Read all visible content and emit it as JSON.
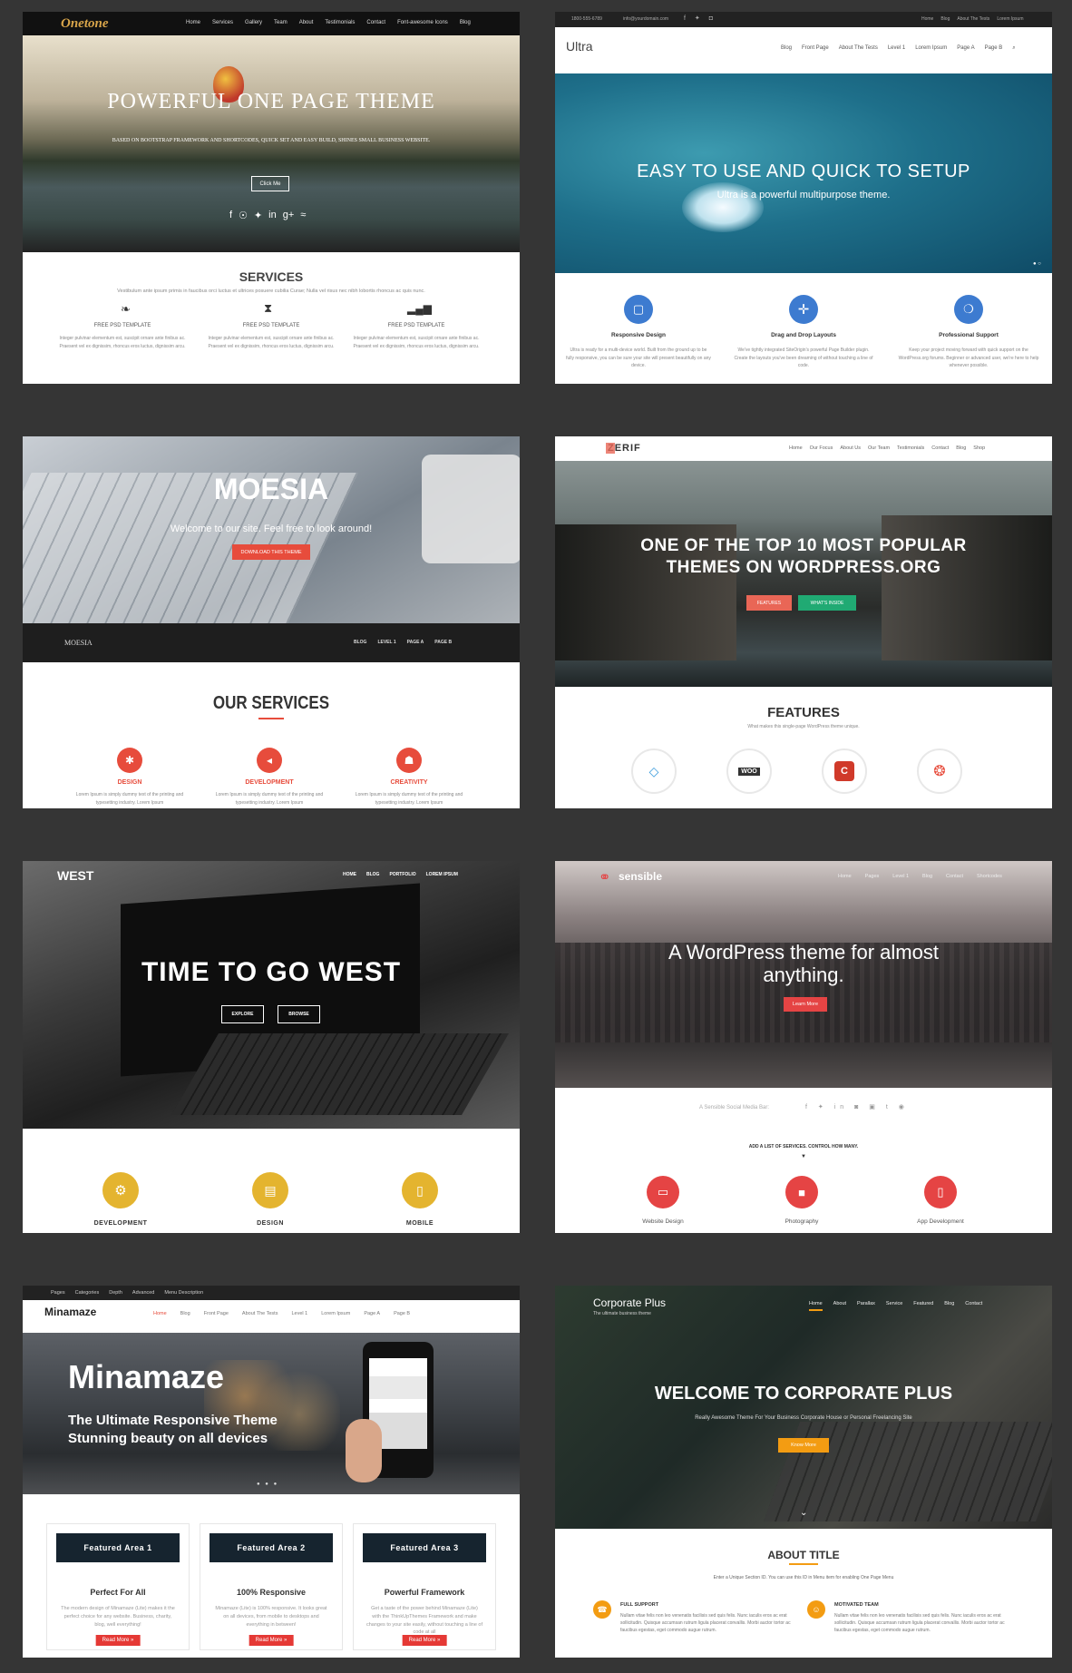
{
  "onetone": {
    "logo": "Onetone",
    "nav": [
      "Home",
      "Services",
      "Gallery",
      "Team",
      "About",
      "Testimonials",
      "Contact",
      "Font-awesome Icons",
      "Blog"
    ],
    "title": "POWERFUL ONE PAGE THEME",
    "subtitle": "BASED ON BOOTSTRAP FRAMEWORK AND SHORTCODES, QUICK SET AND EASY BUILD, SHINES SMALL BUSINESS WEBSITE.",
    "cta": "Click Me",
    "services_title": "SERVICES",
    "services_sub": "Vestibulum ante ipsum primis in faucibus orci luctus et ultrices posuere cubilia Curae; Nulla vel risus nec nibh lobortis rhoncus ac quis nunc.",
    "items": [
      {
        "title": "FREE PSD TEMPLATE",
        "text": "Integer pulvinar elementum est, suscipit ornare ante finibus ac. Praesent vel ex dignissim, rhoncus eros luctus, dignissim arcu."
      },
      {
        "title": "FREE PSD TEMPLATE",
        "text": "Integer pulvinar elementum est, suscipit ornare ante finibus ac. Praesent vel ex dignissim, rhoncus eros luctus, dignissim arcu."
      },
      {
        "title": "FREE PSD TEMPLATE",
        "text": "Integer pulvinar elementum est, suscipit ornare ante finibus ac. Praesent vel ex dignissim, rhoncus eros luctus, dignissim arcu."
      }
    ]
  },
  "ultra": {
    "phone": "1800-555-6789",
    "email": "info@yourdomain.com",
    "topnav": [
      "Home",
      "Blog",
      "About The Tests",
      "Lorem Ipsum"
    ],
    "logo": "Ultra",
    "nav": [
      "Blog",
      "Front Page",
      "About The Tests",
      "Level 1",
      "Lorem Ipsum",
      "Page A",
      "Page B"
    ],
    "title": "EASY TO USE AND QUICK TO SETUP",
    "subtitle": "Ultra is a powerful multipurpose theme.",
    "features": [
      {
        "title": "Responsive Design",
        "text": "Ultra is ready for a multi-device world. Built from the ground up to be fully responsive, you can be sure your site will present beautifully on any device."
      },
      {
        "title": "Drag and Drop Layouts",
        "text": "We've tightly integrated SiteOrigin's powerful Page Builder plugin. Create the layouts you've been dreaming of without touching a line of code."
      },
      {
        "title": "Professional Support",
        "text": "Keep your project moving forward with quick support on the WordPress.org forums. Beginner or advanced user, we're here to help whenever possible."
      }
    ],
    "accent": "#3d7bd0"
  },
  "moesia": {
    "title": "MOESIA",
    "subtitle": "Welcome to our site. Feel free to look around!",
    "cta": "DOWNLOAD THIS THEME",
    "bar_logo": "MOESIA",
    "bar_nav": [
      "BLOG",
      "LEVEL 1",
      "PAGE A",
      "PAGE B"
    ],
    "section": "OUR SERVICES",
    "services": [
      {
        "title": "DESIGN",
        "text": "Lorem Ipsum is simply dummy text of the printing and typesetting industry. Lorem Ipsum"
      },
      {
        "title": "DEVELOPMENT",
        "text": "Lorem Ipsum is simply dummy text of the printing and typesetting industry. Lorem Ipsum"
      },
      {
        "title": "CREATIVITY",
        "text": "Lorem Ipsum is simply dummy text of the printing and typesetting industry. Lorem Ipsum"
      }
    ],
    "accent": "#e74c3c"
  },
  "zerif": {
    "logo": "ZERIF",
    "nav": [
      "Home",
      "Our Focus",
      "About Us",
      "Our Team",
      "Testimonials",
      "Contact",
      "Blog",
      "Shop"
    ],
    "title1": "ONE OF THE TOP 10 MOST POPULAR",
    "title2": "THEMES ON WORDPRESS.ORG",
    "btn1": "FEATURES",
    "btn2": "WHAT'S INSIDE",
    "section": "FEATURES",
    "section_sub": "What makes this single-page WordPress theme unique.",
    "woo": "WOO"
  },
  "west": {
    "logo": "WEST",
    "nav": [
      "HOME",
      "BLOG",
      "PORTFOLIO",
      "LOREM IPSUM"
    ],
    "title": "TIME TO GO WEST",
    "btn1": "EXPLORE",
    "btn2": "BROWSE",
    "services": [
      "DEVELOPMENT",
      "DESIGN",
      "MOBILE"
    ],
    "accent": "#e4b42f"
  },
  "sensible": {
    "logo": "sensible",
    "nav": [
      "Home",
      "Pages",
      "Level 1",
      "Blog",
      "Contact",
      "Shortcodes"
    ],
    "title1": "A WordPress theme for almost",
    "title2": "anything.",
    "cta": "Learn More",
    "social_label": "A Sensible Social Media Bar:",
    "services_title": "ADD A LIST OF SERVICES. CONTROL HOW MANY.",
    "services": [
      "Website Design",
      "Photography",
      "App Development"
    ],
    "accent": "#e54444"
  },
  "minamaze": {
    "topnav": [
      "Pages",
      "Categories",
      "Depth",
      "Advanced",
      "Menu Description"
    ],
    "logo": "Minamaze",
    "nav": [
      "Home",
      "Blog",
      "Front Page",
      "About The Tests",
      "Level 1",
      "Lorem Ipsum",
      "Page A",
      "Page B"
    ],
    "title": "Minamaze",
    "sub1": "The Ultimate Responsive Theme",
    "sub2": "Stunning beauty on all devices",
    "boxes": [
      {
        "head": "Featured Area 1",
        "title": "Perfect For All",
        "text": "The modern design of Minamaze (Lite) makes it the perfect choice for any website. Business, charity, blog, well everything!",
        "btn": "Read More »"
      },
      {
        "head": "Featured Area 2",
        "title": "100% Responsive",
        "text": "Minamaze (Lite) is 100% responsive. It looks great on all devices, from mobile to desktops and everything in between!",
        "btn": "Read More »"
      },
      {
        "head": "Featured Area 3",
        "title": "Powerful Framework",
        "text": "Get a taste of the power behind Minamaze (Lite) with the ThinkUpThemes Framework and make changes to your site easily, without touching a line of code at all",
        "btn": "Read More »"
      }
    ]
  },
  "corporate": {
    "logo": "Corporate Plus",
    "tagline": "The ultimate business theme",
    "nav": [
      "Home",
      "About",
      "Parallax",
      "Service",
      "Featured",
      "Blog",
      "Contact"
    ],
    "title": "WELCOME TO CORPORATE PLUS",
    "subtitle": "Really Awesome Theme For Your Business Corporate House or Personal Freelancing Site",
    "cta": "Know More",
    "about_title": "ABOUT TITLE",
    "about_sub": "Enter a Unique Section ID. You can use this ID in Menu item for enabling One Page Menu",
    "items": [
      {
        "title": "FULL SUPPORT",
        "text": "Nullam vitae felis non leo venenatis facilisis sed quis felis. Nunc iaculis eros ac erat sollicitudin. Quisque accumsan rutrum ligula placerat convallis. Morbi auctor tortor ac faucibus egestas, eget commodo augue rutrum."
      },
      {
        "title": "MOTIVATED TEAM",
        "text": "Nullam vitae felis non leo venenatis facilisis sed quis felis. Nunc iaculis eros ac erat sollicitudin. Quisque accumsan rutrum ligula placerat convallis. Morbi auctor tortor ac faucibus egestas, eget commodo augue rutrum."
      }
    ],
    "accent": "#f39c12"
  }
}
